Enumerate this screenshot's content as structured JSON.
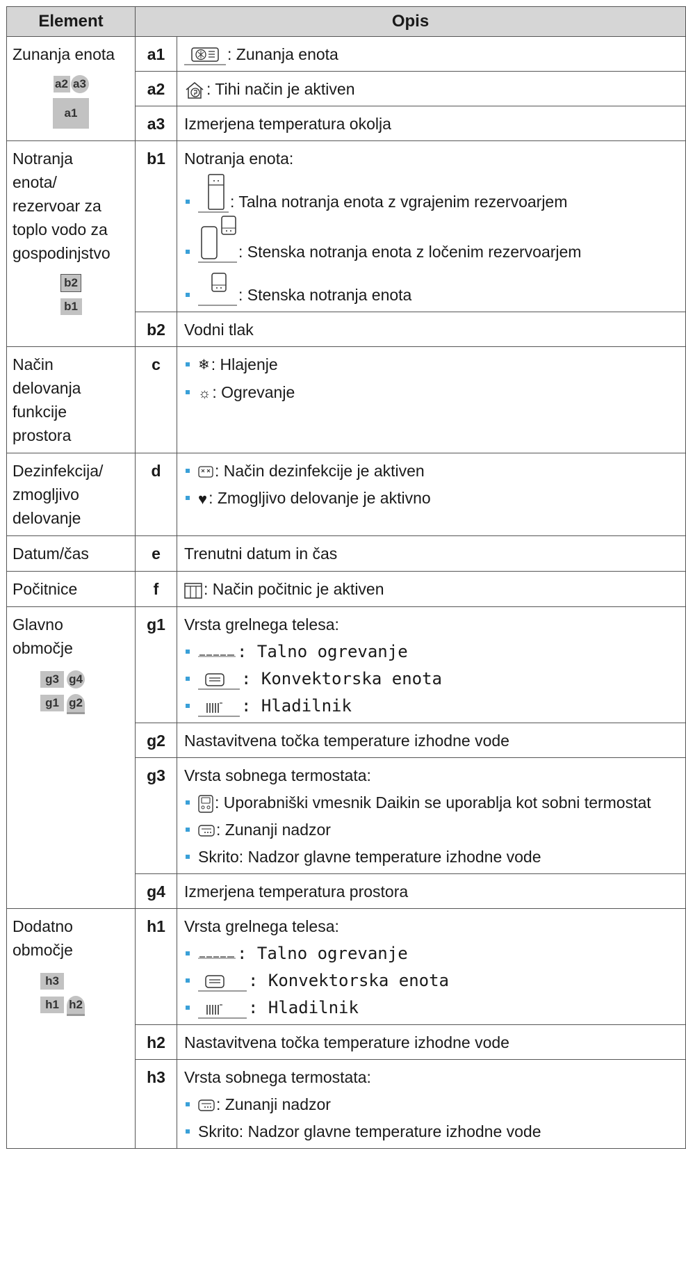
{
  "header": {
    "col_element": "Element",
    "col_desc": "Opis"
  },
  "a": {
    "element": "Zunanja enota",
    "labels": {
      "a1": "a1",
      "a2": "a2",
      "a3": "a3"
    },
    "a1": {
      "code": "a1",
      "desc": ": Zunanja enota"
    },
    "a2": {
      "code": "a2",
      "desc": ": Tihi način je aktiven"
    },
    "a3": {
      "code": "a3",
      "desc": "Izmerjena temperatura okolja"
    }
  },
  "b": {
    "element": [
      "Notranja",
      "enota/",
      "rezervoar za",
      "toplo vodo za",
      "gospodinjstvo"
    ],
    "labels": {
      "b1": "b1",
      "b2": "b2"
    },
    "b1": {
      "code": "b1",
      "intro": "Notranja enota:",
      "items": [
        ": Talna notranja enota z vgrajenim rezervoarjem",
        ": Stenska notranja enota z ločenim rezervoarjem",
        ": Stenska notranja enota"
      ]
    },
    "b2": {
      "code": "b2",
      "desc": "Vodni tlak"
    }
  },
  "c": {
    "element": [
      "Način",
      "delovanja",
      "funkcije",
      "prostora"
    ],
    "code": "c",
    "items": [
      ": Hlajenje",
      ": Ogrevanje"
    ]
  },
  "d": {
    "element": [
      "Dezinfekcija/",
      "zmogljivo",
      "delovanje"
    ],
    "code": "d",
    "items": [
      ": Način dezinfekcije je aktiven",
      ": Zmogljivo delovanje je aktivno"
    ]
  },
  "e": {
    "element": "Datum/čas",
    "code": "e",
    "desc": "Trenutni datum in čas"
  },
  "f": {
    "element": "Počitnice",
    "code": "f",
    "desc": ": Način počitnic je aktiven"
  },
  "g": {
    "element": [
      "Glavno",
      "območje"
    ],
    "labels": {
      "g1": "g1",
      "g2": "g2",
      "g3": "g3",
      "g4": "g4"
    },
    "g1": {
      "code": "g1",
      "intro": "Vrsta grelnega telesa:",
      "items": [
        ": Talno ogrevanje",
        ": Konvektorska enota",
        ": Hladilnik"
      ]
    },
    "g2": {
      "code": "g2",
      "desc": "Nastavitvena točka temperature izhodne vode"
    },
    "g3": {
      "code": "g3",
      "intro": "Vrsta sobnega termostata:",
      "items": [
        ": Uporabniški vmesnik Daikin se uporablja kot sobni termostat",
        ": Zunanji nadzor",
        "Skrito: Nadzor glavne temperature izhodne vode"
      ]
    },
    "g4": {
      "code": "g4",
      "desc": "Izmerjena temperatura prostora"
    }
  },
  "h": {
    "element": [
      "Dodatno",
      "območje"
    ],
    "labels": {
      "h1": "h1",
      "h2": "h2",
      "h3": "h3"
    },
    "h1": {
      "code": "h1",
      "intro": "Vrsta grelnega telesa:",
      "items": [
        ": Talno ogrevanje",
        ": Konvektorska enota",
        ": Hladilnik"
      ]
    },
    "h2": {
      "code": "h2",
      "desc": "Nastavitvena točka temperature izhodne vode"
    },
    "h3": {
      "code": "h3",
      "intro": "Vrsta sobnega termostata:",
      "items": [
        ": Zunanji nadzor",
        "Skrito: Nadzor glavne temperature izhodne vode"
      ]
    }
  },
  "colors": {
    "header_bg": "#d6d6d6",
    "bullet": "#3aa0d8",
    "label_bg": "#c2c2c2",
    "border": "#555555"
  }
}
